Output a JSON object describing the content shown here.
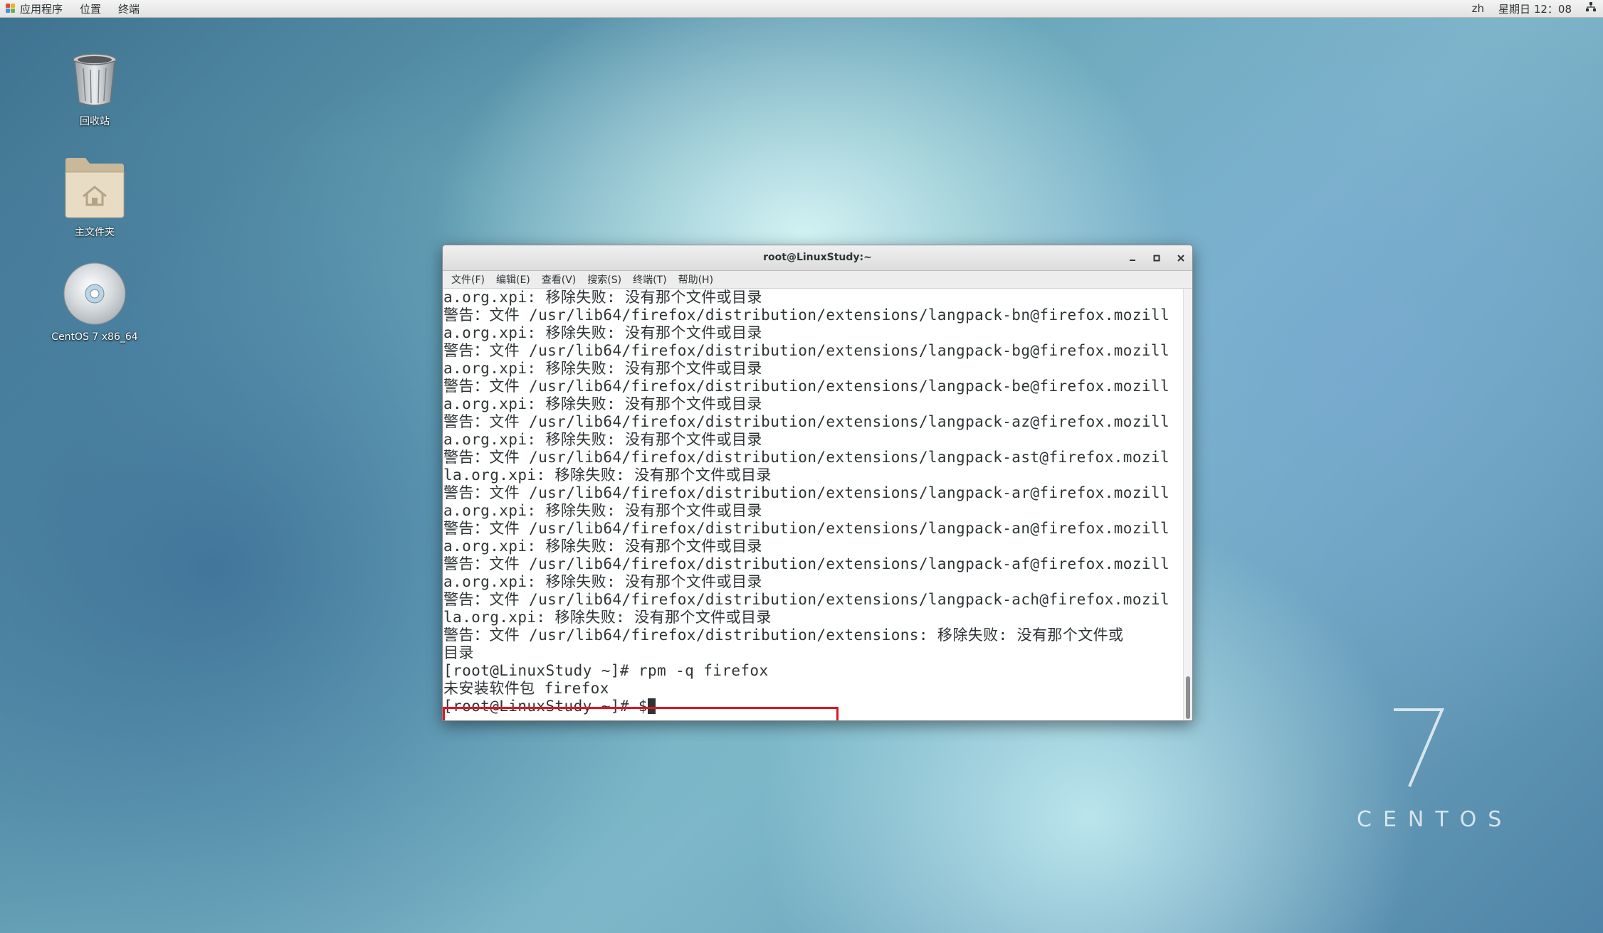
{
  "top_panel": {
    "applications": "应用程序",
    "places": "位置",
    "terminal": "终端",
    "language": "zh",
    "clock": "星期日 12：08"
  },
  "desktop_icons": {
    "trash": "回收站",
    "home": "主文件夹",
    "dvd": "CentOS 7 x86_64"
  },
  "watermark": {
    "number": "7",
    "word": "CENTOS"
  },
  "window": {
    "title": "root@LinuxStudy:~",
    "menu": [
      "文件(F)",
      "编辑(E)",
      "查看(V)",
      "搜索(S)",
      "终端(T)",
      "帮助(H)"
    ]
  },
  "terminal": {
    "lines": [
      "a.org.xpi: 移除失败: 没有那个文件或目录",
      "警告：文件 /usr/lib64/firefox/distribution/extensions/langpack-bn@firefox.mozill",
      "a.org.xpi: 移除失败: 没有那个文件或目录",
      "警告：文件 /usr/lib64/firefox/distribution/extensions/langpack-bg@firefox.mozill",
      "a.org.xpi: 移除失败: 没有那个文件或目录",
      "警告：文件 /usr/lib64/firefox/distribution/extensions/langpack-be@firefox.mozill",
      "a.org.xpi: 移除失败: 没有那个文件或目录",
      "警告：文件 /usr/lib64/firefox/distribution/extensions/langpack-az@firefox.mozill",
      "a.org.xpi: 移除失败: 没有那个文件或目录",
      "警告：文件 /usr/lib64/firefox/distribution/extensions/langpack-ast@firefox.mozil",
      "la.org.xpi: 移除失败: 没有那个文件或目录",
      "警告：文件 /usr/lib64/firefox/distribution/extensions/langpack-ar@firefox.mozill",
      "a.org.xpi: 移除失败: 没有那个文件或目录",
      "警告：文件 /usr/lib64/firefox/distribution/extensions/langpack-an@firefox.mozill",
      "a.org.xpi: 移除失败: 没有那个文件或目录",
      "警告：文件 /usr/lib64/firefox/distribution/extensions/langpack-af@firefox.mozill",
      "a.org.xpi: 移除失败: 没有那个文件或目录",
      "警告：文件 /usr/lib64/firefox/distribution/extensions/langpack-ach@firefox.mozil",
      "la.org.xpi: 移除失败: 没有那个文件或目录",
      "警告：文件 /usr/lib64/firefox/distribution/extensions: 移除失败: 没有那个文件或",
      "目录",
      "[root@LinuxStudy ~]# rpm -q firefox",
      "未安装软件包 firefox",
      "[root@LinuxStudy ~]# $"
    ]
  },
  "colors": {
    "highlight_border": "#e0161f",
    "terminal_text": "#2e3436"
  }
}
